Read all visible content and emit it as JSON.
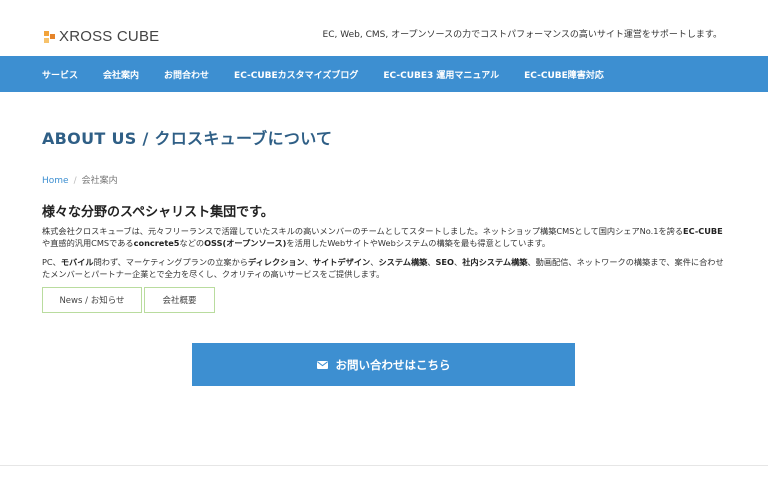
{
  "header": {
    "logo_text": "XROSS CUBE",
    "logo_icon": "cube-logo-icon",
    "tagline": "EC, Web, CMS, オープンソースの力でコストパフォーマンスの高いサイト運営をサポートします。"
  },
  "nav": {
    "items": [
      {
        "label": "サービス"
      },
      {
        "label": "会社案内"
      },
      {
        "label": "お問合わせ"
      },
      {
        "label": "EC-CUBEカスタマイズブログ"
      },
      {
        "label": "EC-CUBE3 運用マニュアル"
      },
      {
        "label": "EC-CUBE障害対応"
      }
    ]
  },
  "page": {
    "title": "ABOUT US / クロスキューブについて"
  },
  "breadcrumb": {
    "home": "Home",
    "separator": "/",
    "current": "会社案内"
  },
  "content": {
    "heading": "様々な分野のスペシャリスト集団です。",
    "p1": [
      "株式会社クロスキューブは、元々フリーランスで活躍していたスキルの高いメンバーのチームとしてスタートしました。ネットショップ構築CMSとして国内シェアNo.1を誇る",
      "EC-CUBE",
      "や直感的汎用CMSである",
      "concrete5",
      "などの",
      "OSS(オープンソース)",
      "を活用したWebサイトやWebシステムの構築を最も得意としています。"
    ],
    "p2": [
      "PC、",
      "モバイル",
      "問わず、マーケティングプランの立案から",
      "ディレクション",
      "、",
      "サイトデザイン",
      "、",
      "システム構築",
      "、",
      "SEO",
      "、",
      "社内システム構築",
      "、動画配信、ネットワークの構築まで、案件に合わせたメンバーとパートナー企業とで全力を尽くし、クオリティの高いサービスをご提供します。"
    ]
  },
  "subtabs": {
    "news": "News / お知らせ",
    "overview": "会社概要"
  },
  "contact": {
    "label": "お問い合わせはこちら",
    "icon": "envelope-icon"
  },
  "colors": {
    "primary": "#3d8fd1",
    "title": "#2f5f86",
    "tab_border": "#b9dc9e"
  }
}
